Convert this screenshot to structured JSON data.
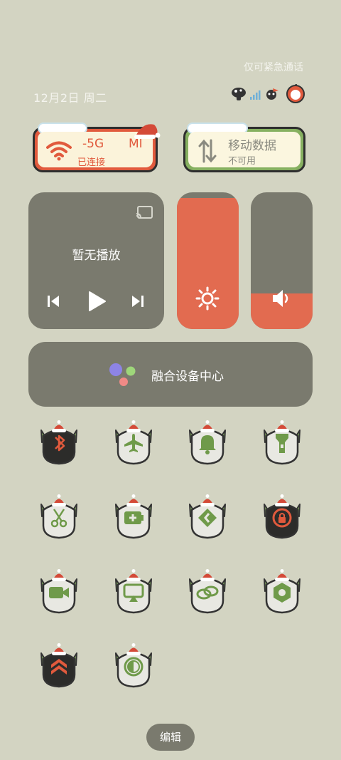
{
  "status": {
    "emergency_text": "仅可紧急通话",
    "date": "12月2日 周二"
  },
  "wifi": {
    "title": "-5G",
    "title_extra": "MI",
    "subtitle": "已连接",
    "accent": "#e15a3d"
  },
  "mobile_data": {
    "title": "移动数据",
    "subtitle": "不可用",
    "accent": "#86b060"
  },
  "media": {
    "title": "暂无播放"
  },
  "brightness": {
    "level": 0.96
  },
  "volume": {
    "level": 0.26
  },
  "fusion": {
    "label": "融合设备中心"
  },
  "tiles": [
    {
      "name": "bluetooth",
      "icon": "bluetooth-icon",
      "state": "off"
    },
    {
      "name": "airplane",
      "icon": "airplane-icon",
      "state": "on"
    },
    {
      "name": "ring",
      "icon": "bell-icon",
      "state": "on"
    },
    {
      "name": "flashlight",
      "icon": "flashlight-icon",
      "state": "on"
    },
    {
      "name": "screenshot",
      "icon": "scissors-icon",
      "state": "on"
    },
    {
      "name": "battery-saver",
      "icon": "battery-plus-icon",
      "state": "on"
    },
    {
      "name": "nearby-share",
      "icon": "share-icon",
      "state": "on"
    },
    {
      "name": "rotation-lock",
      "icon": "rotation-lock-icon",
      "state": "off"
    },
    {
      "name": "screen-record",
      "icon": "video-icon",
      "state": "on"
    },
    {
      "name": "screen-cast",
      "icon": "cast-icon",
      "state": "on"
    },
    {
      "name": "link",
      "icon": "link-icon",
      "state": "on"
    },
    {
      "name": "settings",
      "icon": "hex-nut-icon",
      "state": "on"
    },
    {
      "name": "performance",
      "icon": "chevrons-up-icon",
      "state": "off"
    },
    {
      "name": "dark-mode",
      "icon": "contrast-icon",
      "state": "on"
    }
  ],
  "edit": {
    "label": "编辑"
  },
  "colors": {
    "background": "#d3d4c2",
    "panel": "#7a7a6e",
    "orange": "#e26b50",
    "green": "#86b060",
    "tile_on": "#e8e8e2",
    "tile_off": "#2c2c2a"
  }
}
